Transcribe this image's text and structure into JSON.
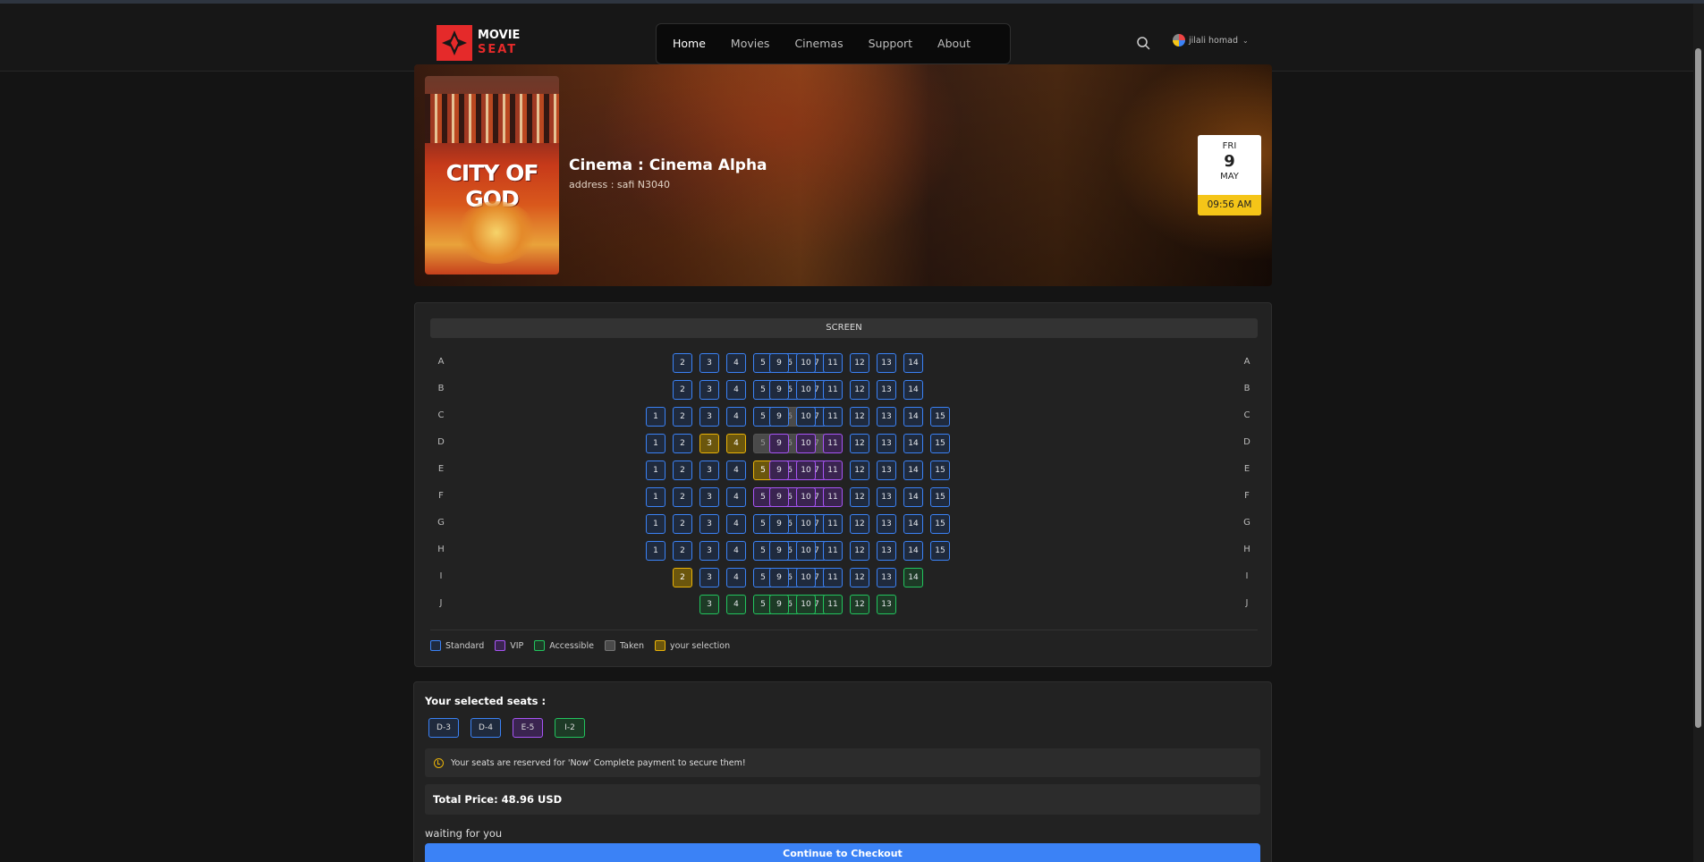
{
  "brand": {
    "line1": "MOVIE",
    "line2": "SEAT"
  },
  "nav": {
    "items": [
      {
        "label": "Home",
        "active": true
      },
      {
        "label": "Movies",
        "active": false
      },
      {
        "label": "Cinemas",
        "active": false
      },
      {
        "label": "Support",
        "active": false
      },
      {
        "label": "About",
        "active": false
      }
    ]
  },
  "header": {
    "search_icon": "search-icon",
    "user_name": "jilali homad",
    "chevron_icon": "chevron-down-icon"
  },
  "movie": {
    "poster_title": "CITY OF GOD",
    "cinema_title": "Cinema : Cinema Alpha",
    "address": "address : safi N3040"
  },
  "showtime": {
    "weekday": "FRI",
    "day": "9",
    "month": "MAY",
    "time": "09:56 AM"
  },
  "seatmap": {
    "screen_label": "SCREEN",
    "rows": [
      {
        "label": "A",
        "left": [
          2,
          3,
          4,
          5,
          6,
          7
        ],
        "right": [
          9,
          10,
          11,
          12,
          13,
          14
        ]
      },
      {
        "label": "B",
        "left": [
          2,
          3,
          4,
          5,
          6,
          7
        ],
        "right": [
          9,
          10,
          11,
          12,
          13,
          14
        ]
      },
      {
        "label": "C",
        "left": [
          1,
          2,
          3,
          4,
          5,
          6,
          7
        ],
        "right": [
          9,
          10,
          11,
          12,
          13,
          14,
          15
        ]
      },
      {
        "label": "D",
        "left": [
          1,
          2,
          3,
          4,
          5,
          6,
          7
        ],
        "right": [
          9,
          10,
          11,
          12,
          13,
          14,
          15
        ]
      },
      {
        "label": "E",
        "left": [
          1,
          2,
          3,
          4,
          5,
          6,
          7
        ],
        "right": [
          9,
          10,
          11,
          12,
          13,
          14,
          15
        ]
      },
      {
        "label": "F",
        "left": [
          1,
          2,
          3,
          4,
          5,
          6,
          7
        ],
        "right": [
          9,
          10,
          11,
          12,
          13,
          14,
          15
        ]
      },
      {
        "label": "G",
        "left": [
          1,
          2,
          3,
          4,
          5,
          6,
          7
        ],
        "right": [
          9,
          10,
          11,
          12,
          13,
          14,
          15
        ]
      },
      {
        "label": "H",
        "left": [
          1,
          2,
          3,
          4,
          5,
          6,
          7
        ],
        "right": [
          9,
          10,
          11,
          12,
          13,
          14,
          15
        ]
      },
      {
        "label": "I",
        "left": [
          2,
          3,
          4,
          5,
          6,
          7
        ],
        "right": [
          9,
          10,
          11,
          12,
          13,
          14
        ]
      },
      {
        "label": "J",
        "left": [
          3,
          4,
          5,
          6,
          7
        ],
        "right": [
          9,
          10,
          11,
          12,
          13
        ]
      }
    ],
    "seat_types": {
      "taken": [
        "C-6",
        "D-5",
        "D-6",
        "D-7"
      ],
      "selected": [
        "D-3",
        "D-4",
        "E-5",
        "I-2"
      ],
      "vip": [
        "D-9",
        "D-10",
        "D-11",
        "E-6",
        "E-7",
        "E-9",
        "E-10",
        "E-11",
        "F-5",
        "F-6",
        "F-7",
        "F-9",
        "F-10",
        "F-11"
      ],
      "accessible": [
        "I-14",
        "J-3",
        "J-4",
        "J-5",
        "J-6",
        "J-7",
        "J-9",
        "J-10",
        "J-11",
        "J-12",
        "J-13"
      ]
    },
    "colors": {
      "standard": "#3b82f6",
      "vip": "#a855f7",
      "accessible": "#22c55e",
      "taken": "#555555",
      "selection": "#eab308"
    },
    "legend": [
      "Standard",
      "VIP",
      "Accessible",
      "Taken",
      "your selection"
    ]
  },
  "selection": {
    "title": "Your selected seats :",
    "chips": [
      {
        "label": "D-3",
        "type": "std"
      },
      {
        "label": "D-4",
        "type": "std"
      },
      {
        "label": "E-5",
        "type": "vip"
      },
      {
        "label": "I-2",
        "type": "acc"
      }
    ],
    "notice": "Your seats are reserved for 'Now' Complete payment to secure them!",
    "total": "Total Price: 48.96 USD",
    "waiting": "waiting for you",
    "checkout_label": "Continue to Checkout"
  }
}
